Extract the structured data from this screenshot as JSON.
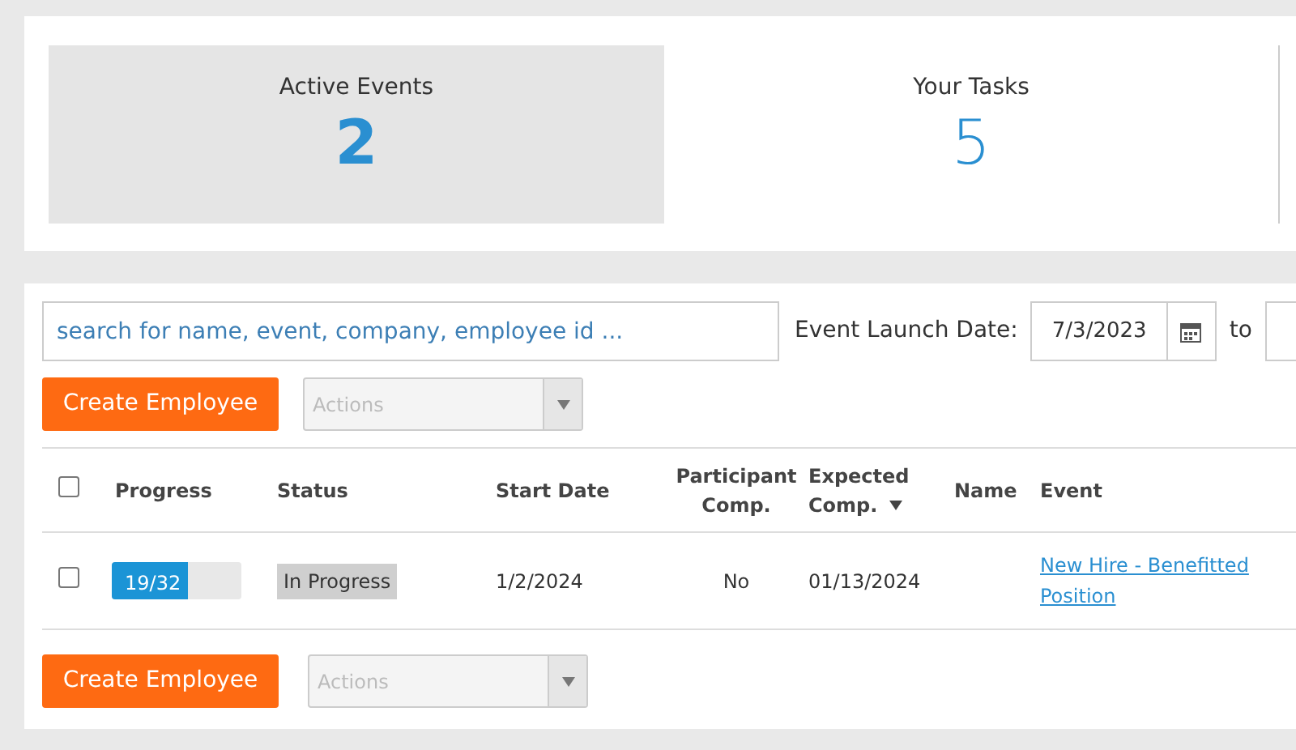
{
  "summary": [
    {
      "label": "Active Events",
      "value": "2",
      "selected": true
    },
    {
      "label": "Your Tasks",
      "value": "5",
      "selected": false
    }
  ],
  "search": {
    "placeholder": "search for name, event, company, employee id ..."
  },
  "date_filter": {
    "label": "Event Launch Date:",
    "from": "7/3/2023",
    "to_label": "to"
  },
  "top_toolbar": {
    "create_button": "Create Employee",
    "actions_placeholder": "Actions"
  },
  "table": {
    "select_all_checked": false,
    "columns": [
      {
        "label": "Progress",
        "sorted": false
      },
      {
        "label": "Status",
        "sorted": false
      },
      {
        "label": "Start Date",
        "sorted": false
      },
      {
        "label": "Participant Comp.",
        "sorted": false
      },
      {
        "label": "Expected Comp.",
        "sorted": true
      },
      {
        "label": "Name",
        "sorted": false
      },
      {
        "label": "Event",
        "sorted": false
      }
    ],
    "rows": [
      {
        "checked": false,
        "progress": "19/32",
        "level": 0.59,
        "status": "In Progress",
        "start_date": "1/2/2024",
        "participant_comp": "No",
        "expected_comp": "01/13/2024",
        "event": "New Hire - Benefitted Position"
      }
    ]
  },
  "bottom_toolbar": {
    "create_button": "Create Employee",
    "actions_placeholder": "Actions"
  }
}
